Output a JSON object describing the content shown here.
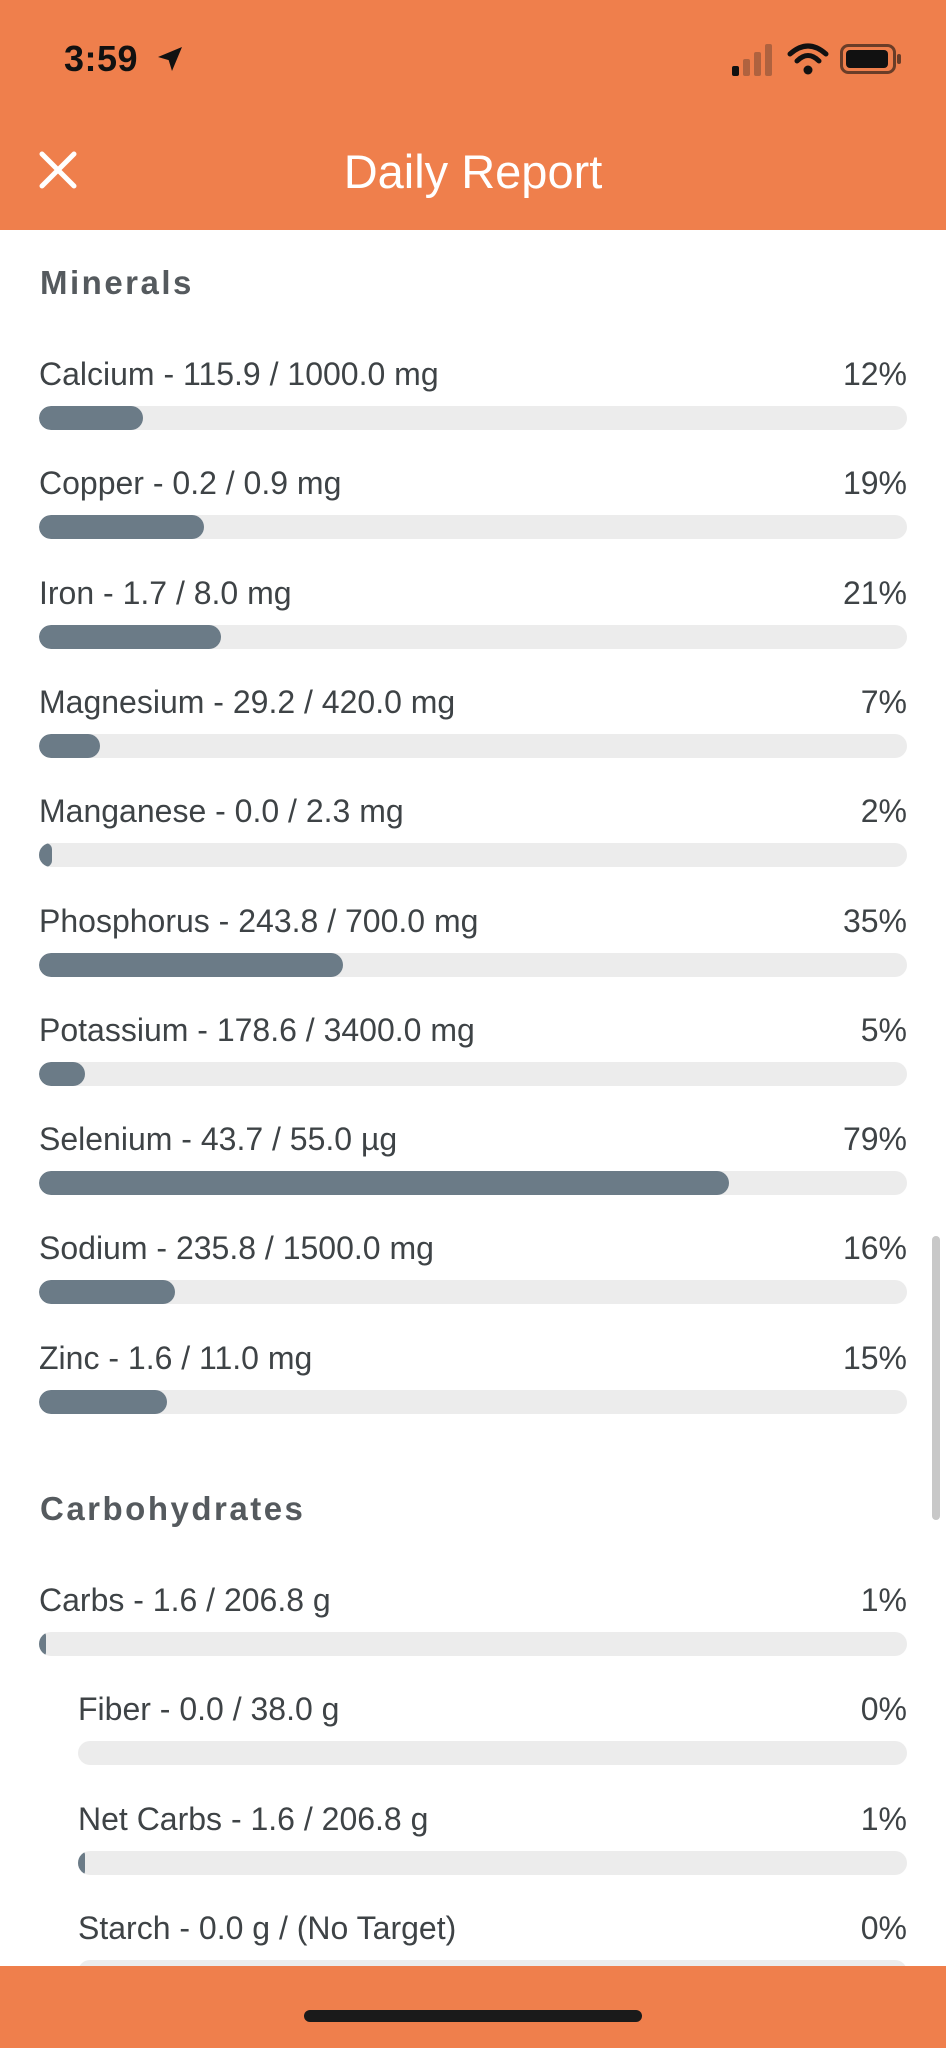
{
  "status_bar": {
    "time": "3:59"
  },
  "header": {
    "title": "Daily Report"
  },
  "sections": {
    "minerals": {
      "title": "Minerals",
      "rows": [
        {
          "label": "Calcium - 115.9 / 1000.0 mg",
          "percent": "12%",
          "progress": 0.12
        },
        {
          "label": "Copper - 0.2 / 0.9 mg",
          "percent": "19%",
          "progress": 0.19
        },
        {
          "label": "Iron - 1.7 / 8.0 mg",
          "percent": "21%",
          "progress": 0.21
        },
        {
          "label": "Magnesium - 29.2 / 420.0 mg",
          "percent": "7%",
          "progress": 0.07
        },
        {
          "label": "Manganese - 0.0 / 2.3 mg",
          "percent": "2%",
          "progress": 0.015
        },
        {
          "label": "Phosphorus - 243.8 / 700.0 mg",
          "percent": "35%",
          "progress": 0.35
        },
        {
          "label": "Potassium - 178.6 / 3400.0 mg",
          "percent": "5%",
          "progress": 0.053
        },
        {
          "label": "Selenium - 43.7 / 55.0 µg",
          "percent": "79%",
          "progress": 0.795
        },
        {
          "label": "Sodium - 235.8 / 1500.0 mg",
          "percent": "16%",
          "progress": 0.157
        },
        {
          "label": "Zinc - 1.6 / 11.0 mg",
          "percent": "15%",
          "progress": 0.148
        }
      ]
    },
    "carbohydrates": {
      "title": "Carbohydrates",
      "rows": [
        {
          "label": "Carbs - 1.6 / 206.8 g",
          "percent": "1%",
          "progress": 0.008,
          "indent": false
        },
        {
          "label": "Fiber - 0.0 / 38.0 g",
          "percent": "0%",
          "progress": 0,
          "indent": true
        },
        {
          "label": "Net Carbs - 1.6 / 206.8 g",
          "percent": "1%",
          "progress": 0.008,
          "indent": true
        },
        {
          "label": "Starch - 0.0 g / (No Target)",
          "percent": "0%",
          "progress": 0,
          "indent": true
        }
      ]
    }
  },
  "colors": {
    "accent": "#ef7f4c",
    "bar_fill": "#6b7b87",
    "bar_track": "#ececec"
  },
  "icons": [
    "location-arrow-icon",
    "cellular-signal-icon",
    "wifi-icon",
    "battery-icon",
    "close-icon"
  ]
}
